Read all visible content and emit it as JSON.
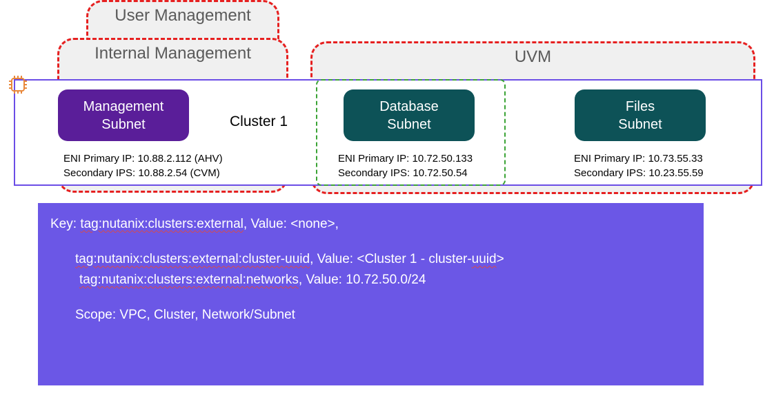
{
  "boxes": {
    "user_management": "User Management",
    "internal_management": "Internal Management",
    "uvm": "UVM"
  },
  "cluster_label": "Cluster 1",
  "subnets": {
    "management": {
      "line1": "Management",
      "line2": "Subnet",
      "ip_primary": "ENI Primary IP: 10.88.2.112 (AHV)",
      "ip_secondary": "Secondary IPS: 10.88.2.54 (CVM)"
    },
    "database": {
      "line1": "Database",
      "line2": "Subnet",
      "ip_primary": "ENI Primary IP: 10.72.50.133",
      "ip_secondary": "Secondary IPS: 10.72.50.54"
    },
    "files": {
      "line1": "Files",
      "line2": "Subnet",
      "ip_primary": "ENI Primary IP: 10.73.55.33",
      "ip_secondary": "Secondary IPS: 10.23.55.59"
    }
  },
  "panel": {
    "l1_key_label": "Key: ",
    "l1_key_val": "tag:nutanix:clusters:external",
    "l1_rest": ", Value: <none>,",
    "l2_key": "tag:nutanix:clusters:external:cluster-uuid",
    "l2_rest": ", Value: <Cluster 1 - cluster-",
    "l2_uuid": "uuid",
    "l2_close": ">",
    "l3_key": "tag:nutanix:clusters:external:networks",
    "l3_rest": ", Value: 10.72.50.0/24",
    "l4": "Scope: VPC, Cluster, Network/Subnet"
  }
}
